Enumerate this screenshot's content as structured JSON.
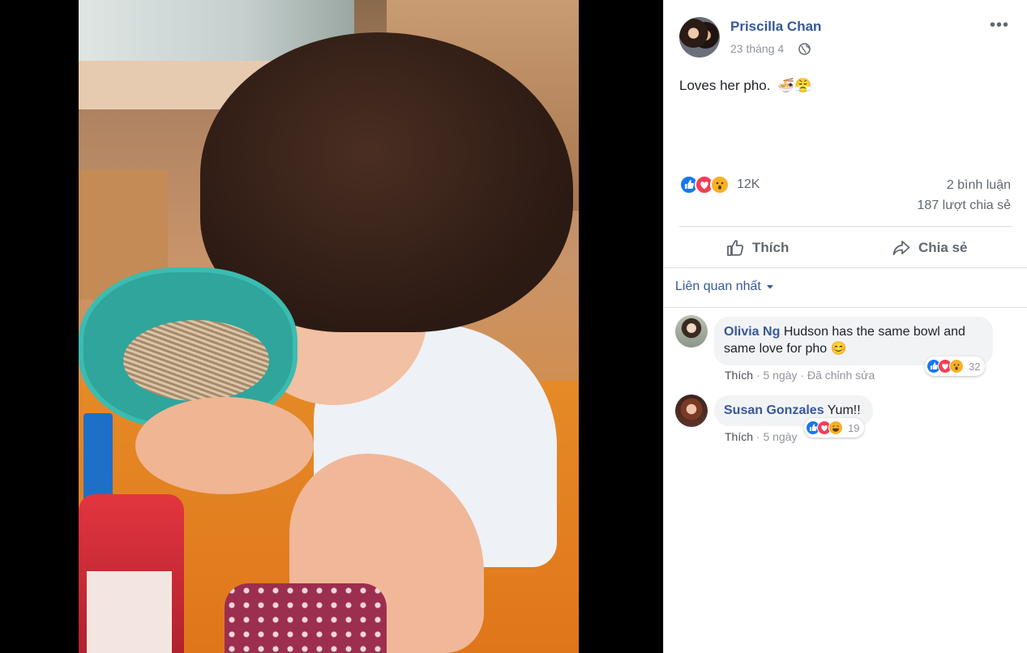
{
  "post": {
    "author": "Priscilla Chan",
    "date": "23 tháng 4",
    "text": "Loves her pho.",
    "emoji": "🍜😤",
    "privacy_icon": "globe-icon",
    "reaction_count": "12K",
    "comments_count": "2 bình luận",
    "shares_count": "187 lượt chia sẻ"
  },
  "actions": {
    "like_label": "Thích",
    "share_label": "Chia sẻ"
  },
  "sort": {
    "label": "Liên quan nhất"
  },
  "comments": [
    {
      "author": "Olivia Ng",
      "text": "Hudson has the same bowl and same love for pho",
      "emoji": "😊",
      "like_label": "Thích",
      "time": "5 ngày",
      "edited": "Đã chỉnh sửa",
      "reaction_count": "32"
    },
    {
      "author": "Susan Gonzales",
      "text": "Yum!!",
      "like_label": "Thích",
      "time": "5 ngày",
      "reaction_count": "19"
    }
  ],
  "colors": {
    "link_blue": "#365899",
    "like_blue": "#1877f2",
    "love_red": "#f33e58",
    "wow_yellow": "#f7b125",
    "muted": "#90949c"
  }
}
